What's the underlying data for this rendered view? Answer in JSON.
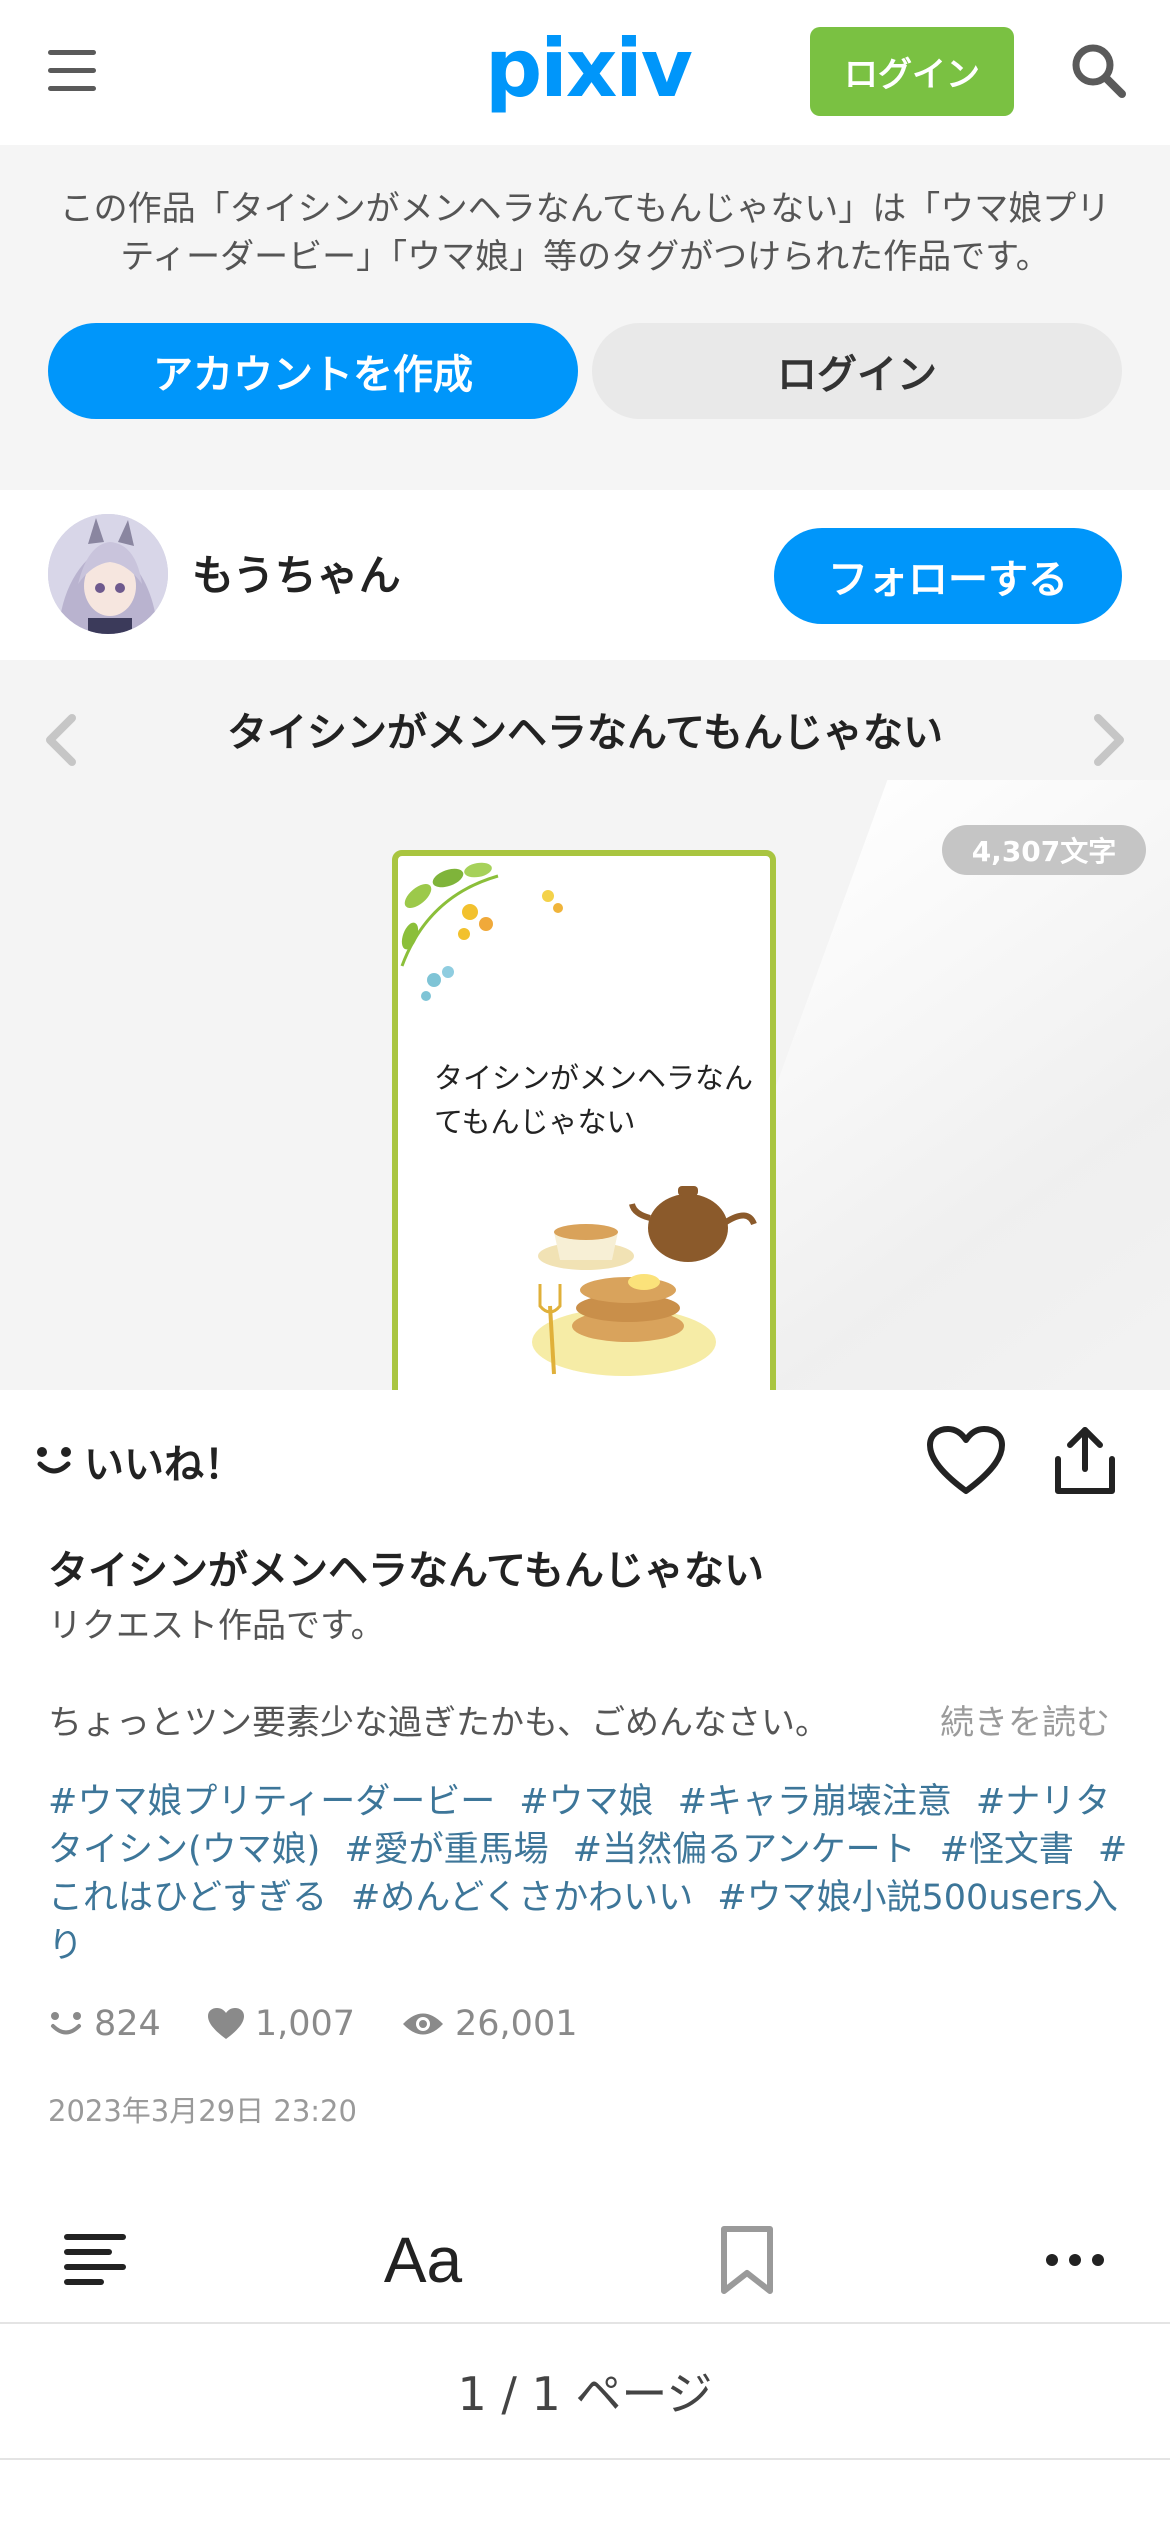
{
  "header": {
    "logo": "pixiv",
    "login_label": "ログイン"
  },
  "notice": {
    "text": "この作品「タイシンがメンヘラなんてもんじゃない」は「ウマ娘プリティーダービー」「ウマ娘」等のタグがつけられた作品です。",
    "create_account_label": "アカウントを作成",
    "login_label": "ログイン"
  },
  "author": {
    "name": "もうちゃん",
    "follow_label": "フォローする"
  },
  "work": {
    "title": "タイシンがメンヘラなんてもんじゃない",
    "char_count": "4,307文字",
    "cover_title": "タイシンがメンヘラなんてもんじゃない"
  },
  "actions": {
    "like_label": "いいね！"
  },
  "caption": {
    "title": "タイシンがメンヘラなんてもんじゃない",
    "subtitle": "リクエスト作品です。",
    "line": "ちょっとツン要素少な過ぎたかも、ごめんなさい。",
    "read_more": "続きを読む"
  },
  "tags": [
    "#ウマ娘プリティーダービー",
    "#ウマ娘",
    "#キャラ崩壊注意",
    "#ナリタタイシン(ウマ娘)",
    "#愛が重馬場",
    "#当然偏るアンケート",
    "#怪文書",
    "#これはひどすぎる",
    "#めんどくさかわいい",
    "#ウマ娘小説500users入り"
  ],
  "stats": {
    "likes": "824",
    "bookmarks": "1,007",
    "views": "26,001"
  },
  "date": "2023年3月29日 23:20",
  "toolbar": {
    "font_label": "Aa"
  },
  "pager": "1 / 1 ページ",
  "colors": {
    "brand": "#0096fa",
    "login_green": "#7ac142",
    "tag": "#3d7699",
    "cover_border": "#a9c540"
  }
}
